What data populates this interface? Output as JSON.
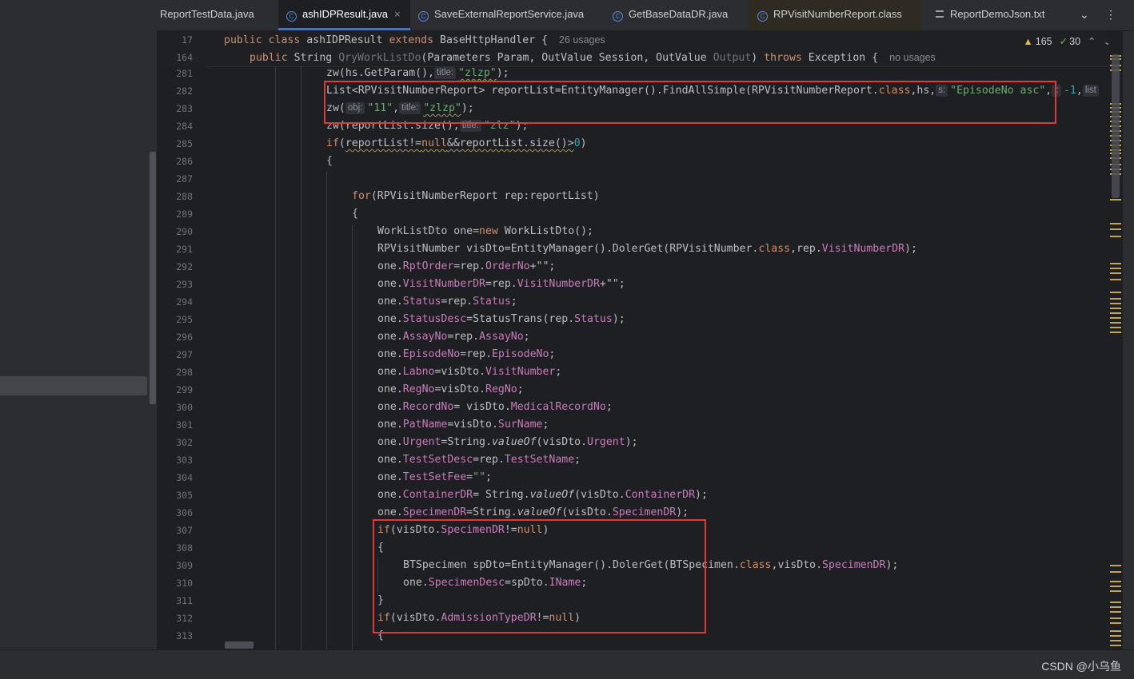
{
  "tabs": [
    {
      "label": "ReportTestData.java",
      "icon": "",
      "active": false
    },
    {
      "label": "ashIDPResult.java",
      "icon": "class-icon",
      "active": true,
      "close": "×"
    },
    {
      "label": "SaveExternalReportService.java",
      "icon": "class-icon",
      "active": false
    },
    {
      "label": "GetBaseDataDR.java",
      "icon": "class-icon",
      "active": false
    },
    {
      "label": "RPVisitNumberReport.class",
      "icon": "class-icon",
      "active": false
    },
    {
      "label": "ReportDemoJson.txt",
      "icon": "text-file-icon",
      "active": false
    }
  ],
  "tab_controls": {
    "more": "⌄",
    "menu": "⋮"
  },
  "inspections": {
    "warnings": "165",
    "checks": "30",
    "up": "⌃",
    "down": "⌄"
  },
  "sticky_lines": [
    {
      "number": "17",
      "usages": "26 usages"
    },
    {
      "number": "164",
      "usages": "no usages"
    }
  ],
  "line_numbers": [
    "281",
    "282",
    "283",
    "284",
    "285",
    "286",
    "287",
    "288",
    "289",
    "290",
    "291",
    "292",
    "293",
    "294",
    "295",
    "296",
    "297",
    "298",
    "299",
    "300",
    "301",
    "302",
    "303",
    "304",
    "305",
    "306",
    "307",
    "308",
    "309",
    "310",
    "311",
    "312",
    "313"
  ],
  "hints": {
    "title": "title:",
    "s": "s:",
    "i": "i:",
    "list": "list",
    "obj": "obj:"
  },
  "code": {
    "public": "public",
    "class": "class",
    "extends": "extends",
    "class_name": "ashIDPResult",
    "base_class": "BaseHttpHandler {",
    "string_type": "String",
    "method_name": "QryWorkListDo",
    "params": "(Parameters Param, OutValue Session, OutValue",
    "output_param": "Output",
    "close_params": ")",
    "throws": "throws",
    "exception": "Exception {",
    "l281_a": "zw(hs.GetParam(),",
    "l281_str": "\"zlzp\"",
    "l281_b": ");",
    "l282_a": "List<RPVisitNumberReport> reportList=EntityManager().FindAllSimple(RPVisitNumberReport.",
    "l282_class": "class",
    "l282_b": ",hs,",
    "l282_str": "\"EpisodeNo asc\"",
    "l282_c": ",",
    "l282_num": "-1",
    "l282_d": ",",
    "l283_a": "zw(",
    "l283_str1": "\"11\"",
    "l283_comma": ",",
    "l283_str2": "\"zlzp\"",
    "l283_b": ");",
    "l284_a": "zw(reportList.size(),",
    "l284_str": "\"zlz\"",
    "l284_b": ");",
    "if": "if",
    "l285_a": "(",
    "l285_w1": "reportList!=",
    "null": "null",
    "l285_w2": "&&reportList.size()>",
    "zero": "0",
    "l285_b": ")",
    "brace_open": "{",
    "brace_close": "}",
    "for": "for",
    "l288": "(RPVisitNumberReport rep:reportList)",
    "l290_a": "WorkListDto one=",
    "new": "new",
    "l290_b": " WorkListDto();",
    "l291_a": "RPVisitNumber visDto=EntityManager().DolerGet(RPVisitNumber.",
    "l291_b": ",rep.",
    "l291_f": "VisitNumberDR",
    "l291_c": ");",
    "one": "one.",
    "rep": "rep.",
    "visdto": "visDto.",
    "eq": "=",
    "semi": ";",
    "f_RptOrder": "RptOrder",
    "f_OrderNo": "OrderNo",
    "plus_empty": "+\"\";",
    "f_VisitNumberDR": "VisitNumberDR",
    "f_Status": "Status",
    "f_StatusDesc": "StatusDesc",
    "status_trans": "StatusTrans(rep.",
    "close_semi": ");",
    "f_AssayNo": "AssayNo",
    "f_EpisodeNo": "EpisodeNo",
    "f_Labno": "Labno",
    "f_VisitNumber": "VisitNumber",
    "f_RegNo": "RegNo",
    "f_RecordNo": "RecordNo",
    "eq_space": "= visDto.",
    "f_MedicalRecordNo": "MedicalRecordNo",
    "f_PatName": "PatName",
    "f_SurName": "SurName",
    "f_Urgent": "Urgent",
    "string_cls": "=String.",
    "string_cls_sp": "= String.",
    "valueof": "valueOf",
    "paren_vis": "(visDto.",
    "f_TestSetDesc": "TestSetDesc",
    "f_TestSetName": "TestSetName",
    "f_TestSetFee": "TestSetFee",
    "empty_str": "\"\"",
    "f_ContainerDR": "ContainerDR",
    "f_SpecimenDR": "SpecimenDR",
    "neq": "!=",
    "paren_close": ")",
    "l309_a": "BTSpecimen spDto=EntityManager().DolerGet(BTSpecimen.",
    "l309_b": ",visDto.",
    "f_SpecimenDesc": "SpecimenDesc",
    "spdto": "spDto.",
    "f_IName": "IName",
    "f_AdmissionTypeDR": "AdmissionTypeDR"
  },
  "watermark": "CSDN @小乌鱼",
  "colors": {
    "accent": "#3574f0",
    "highlight_box": "#e0393a",
    "keyword": "#cf8e6d",
    "string": "#6aab73",
    "field": "#c77dbb",
    "number": "#2aacb8"
  }
}
